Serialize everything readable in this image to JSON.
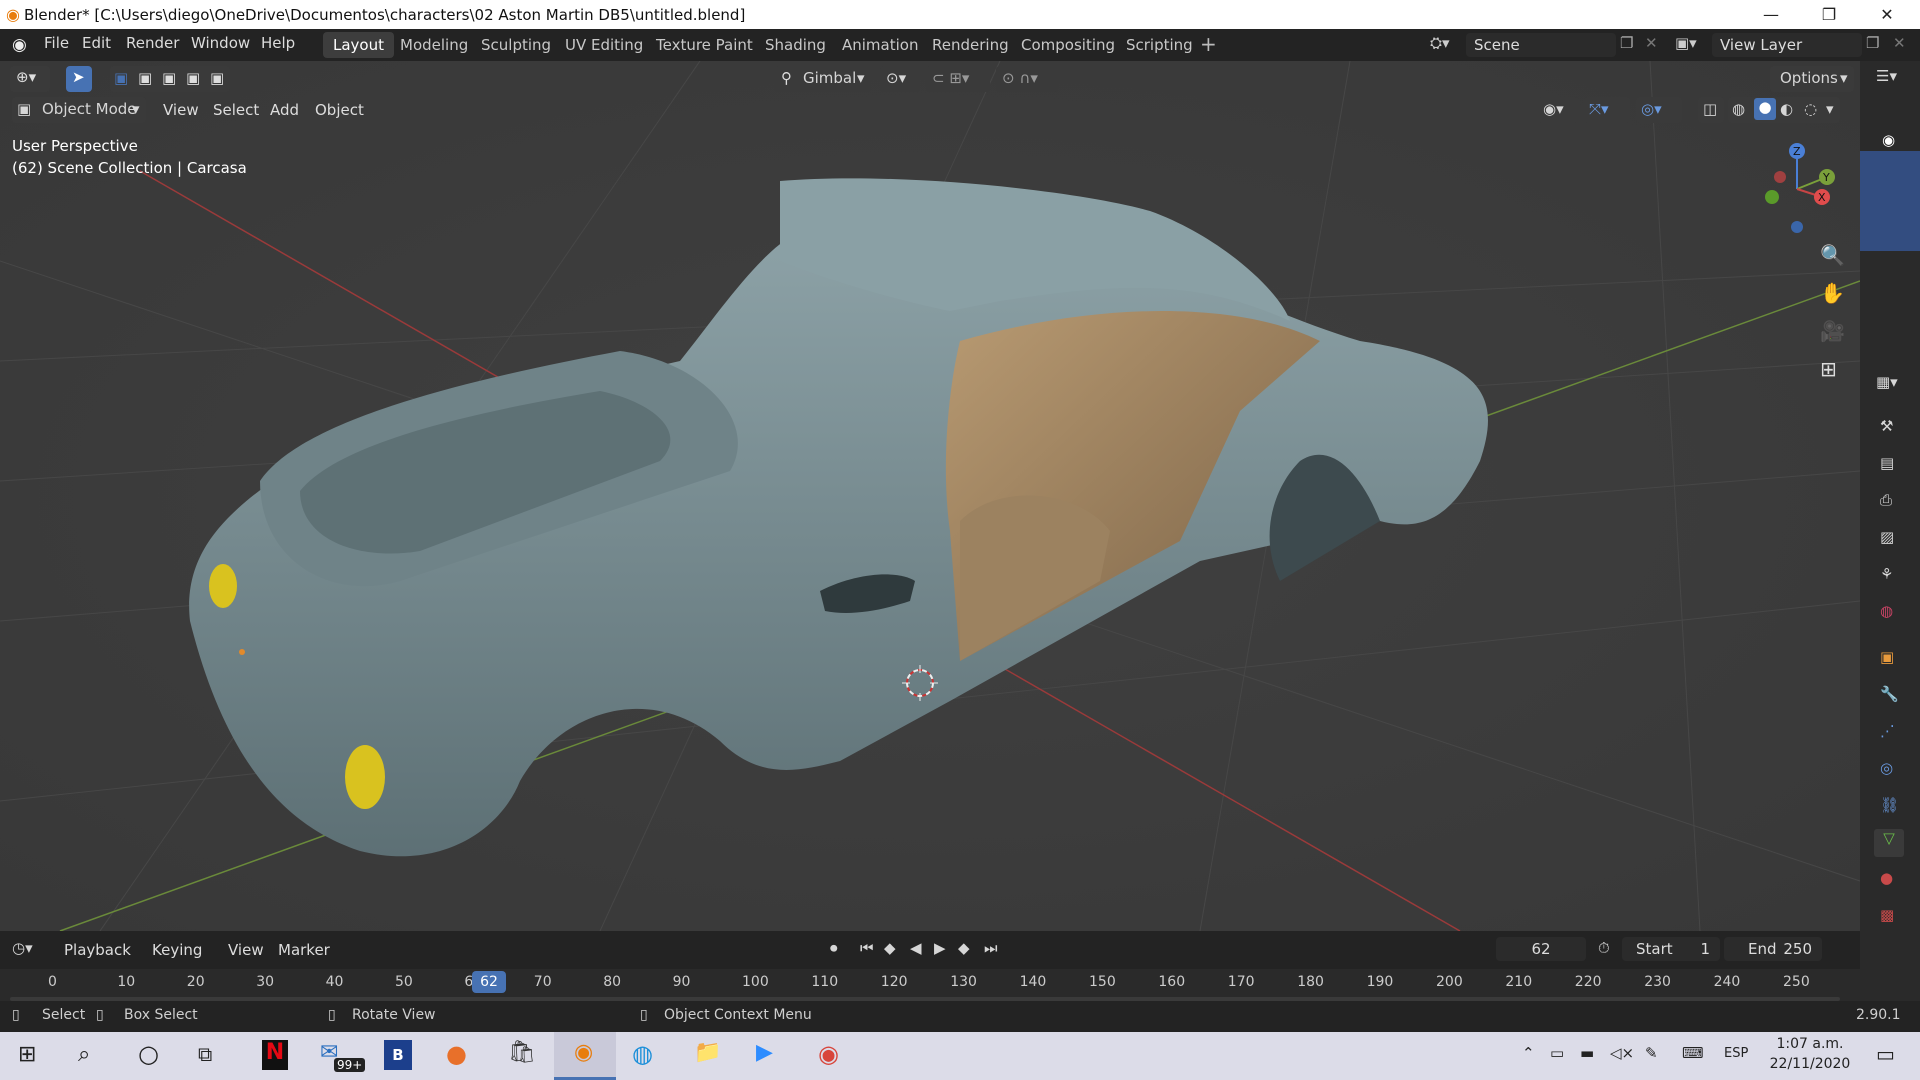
{
  "window": {
    "title": "Blender* [C:\\Users\\diego\\OneDrive\\Documentos\\characters\\02 Aston Martin DB5\\untitled.blend]"
  },
  "menus": [
    "File",
    "Edit",
    "Render",
    "Window",
    "Help"
  ],
  "workspaces": [
    "Layout",
    "Modeling",
    "Sculpting",
    "UV Editing",
    "Texture Paint",
    "Shading",
    "Animation",
    "Rendering",
    "Compositing",
    "Scripting"
  ],
  "active_workspace": "Layout",
  "scene": {
    "label": "Scene",
    "view_layer": "View Layer"
  },
  "tool_header": {
    "orientation": "Gimbal",
    "options": "Options"
  },
  "viewport_header": {
    "mode": "Object Mode",
    "menus": [
      "View",
      "Select",
      "Add",
      "Object"
    ]
  },
  "overlay_text": {
    "perspective": "User Perspective",
    "collection": "(62) Scene Collection | Carcasa"
  },
  "gizmo": {
    "z": "Z",
    "y": "Y",
    "x": "X"
  },
  "timeline": {
    "menus": [
      "Playback",
      "Keying",
      "View",
      "Marker"
    ],
    "current_frame": "62",
    "start_label": "Start",
    "start": "1",
    "end_label": "End",
    "end": "250",
    "ticks": [
      "0",
      "10",
      "20",
      "30",
      "40",
      "50",
      "6",
      "70",
      "80",
      "90",
      "100",
      "110",
      "120",
      "130",
      "140",
      "150",
      "160",
      "170",
      "180",
      "190",
      "200",
      "210",
      "220",
      "230",
      "240",
      "250"
    ],
    "playhead_label": "62"
  },
  "status": {
    "select": "Select",
    "box_select": "Box Select",
    "rotate": "Rotate View",
    "context": "Object Context Menu",
    "version": "2.90.1"
  },
  "taskbar": {
    "lang": "ESP",
    "time": "1:07 a.m.",
    "date": "22/11/2020",
    "mail_badge": "99+",
    "b_app": "B"
  },
  "colors": {
    "car_body": "#7f959a",
    "car_interior": "#a88c66",
    "headlight": "#d9c21f",
    "grid_x": "#9a3a3a",
    "grid_y": "#6a8a3a",
    "accent": "#4772b3"
  }
}
